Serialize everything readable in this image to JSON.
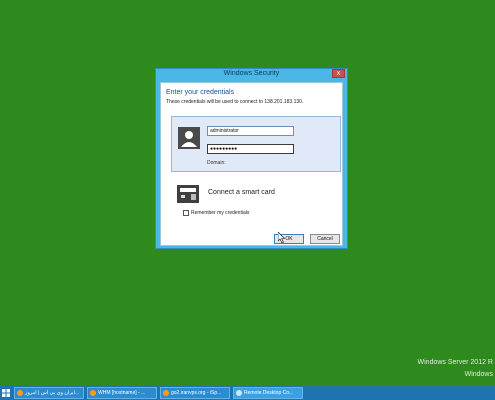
{
  "dialog": {
    "title": "Windows Security",
    "close_label": "x",
    "heading": "Enter your credentials",
    "subtext": "These credentials will be used to connect to 138.201.183.130.",
    "username_value": "administrator",
    "password_value": "●●●●●●●●●",
    "domain_label": "Domain:",
    "smartcard_label": "Connect a smart card",
    "remember_label": "Remember my credentials",
    "remember_checked": false,
    "ok_label": "OK",
    "cancel_label": "Cancel"
  },
  "desktop": {
    "watermark_line1": "Windows Server 2012 R",
    "watermark_line2": "Windows"
  },
  "taskbar": {
    "items": [
      {
        "label": "ایران وی پی اس | امروز...",
        "icon": "firefox-icon"
      },
      {
        "label": "WHM [hostname] - ...",
        "icon": "firefox-icon"
      },
      {
        "label": "go2.iranvps.org - iSp...",
        "icon": "firefox-icon"
      },
      {
        "label": "Remote Desktop Co...",
        "icon": "remote-desktop-icon"
      }
    ]
  },
  "colors": {
    "desktop_bg": "#2f8a1d",
    "dialog_frame": "#4bb7e6",
    "taskbar_bg": "#1e74b0"
  }
}
